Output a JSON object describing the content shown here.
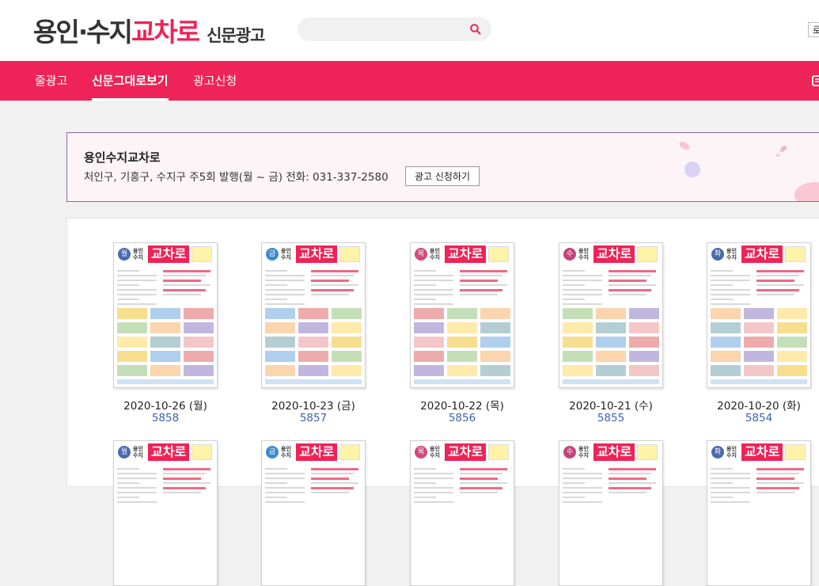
{
  "header": {
    "logo_part1": "용인·수지",
    "logo_part2": "교차로",
    "logo_part3": "신문광고",
    "search_placeholder": "",
    "search_icon": "search-icon",
    "login_label": "로그인"
  },
  "nav": {
    "tabs": [
      {
        "label": "줄광고"
      },
      {
        "label": "신문그대로보기",
        "active": true
      },
      {
        "label": "광고신청"
      }
    ]
  },
  "info": {
    "title": "용인수지교차로",
    "description": "처인구, 기흥구, 수지구 주5회 발행(월 ~ 금) 전화: 031-337-2580",
    "apply_label": "광고 신청하기"
  },
  "papers": [
    {
      "date": "2020-10-26 (월)",
      "issue": "5858",
      "day": "월"
    },
    {
      "date": "2020-10-23 (금)",
      "issue": "5857",
      "day": "금"
    },
    {
      "date": "2020-10-22 (목)",
      "issue": "5856",
      "day": "목"
    },
    {
      "date": "2020-10-21 (수)",
      "issue": "5855",
      "day": "수"
    },
    {
      "date": "2020-10-20 (화)",
      "issue": "5854",
      "day": "화"
    }
  ],
  "papers_row2": [
    {
      "day": "월"
    },
    {
      "day": "금"
    },
    {
      "day": "목"
    },
    {
      "day": "수"
    },
    {
      "day": "화"
    }
  ],
  "thumbnail_masthead": {
    "region": "용인 수지",
    "title": "교차로"
  },
  "colors": {
    "brand": "#ee2357",
    "link": "#3a62a8",
    "border_accent": "#8a6ab0"
  }
}
